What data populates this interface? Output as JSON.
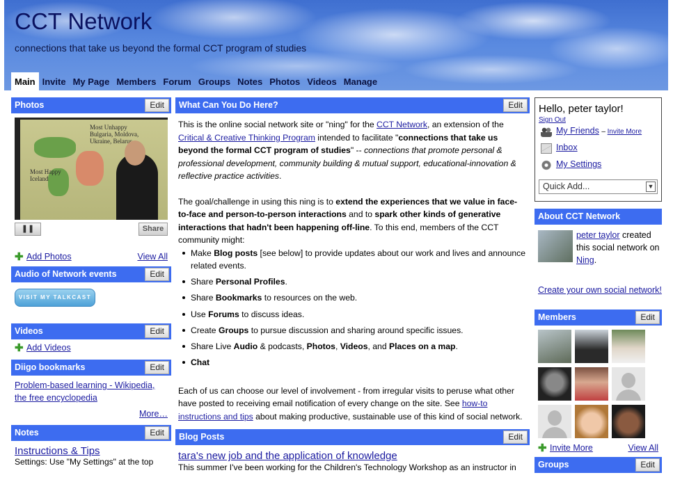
{
  "header": {
    "title": "CCT Network",
    "tagline": "connections that take us beyond the formal CCT program of studies"
  },
  "nav": {
    "tabs": [
      {
        "label": "Main"
      },
      {
        "label": "Invite"
      },
      {
        "label": "My Page"
      },
      {
        "label": "Members"
      },
      {
        "label": "Forum"
      },
      {
        "label": "Groups"
      },
      {
        "label": "Notes"
      },
      {
        "label": "Photos"
      },
      {
        "label": "Videos"
      },
      {
        "label": "Manage"
      }
    ],
    "active": "Main"
  },
  "common": {
    "edit_label": "Edit"
  },
  "left": {
    "photos": {
      "title": "Photos",
      "slide_text_1": "Most Unhappy Bulgaria, Moldova, Ukraine, Belarus",
      "slide_text_2": "Most Happy Iceland",
      "pause_label": "❚❚",
      "share_label": "Share",
      "add_label": "Add Photos",
      "view_all_label": "View All"
    },
    "audio": {
      "title": "Audio of Network events",
      "talkcast_label": "VISIT MY TALKCAST"
    },
    "videos": {
      "title": "Videos",
      "add_label": "Add Videos"
    },
    "diigo": {
      "title": "Diigo bookmarks",
      "link": "Problem-based learning - Wikipedia, the free encyclopedia",
      "more_label": "More…"
    },
    "notes": {
      "title": "Notes",
      "note_title": "Instructions & Tips",
      "note_sub": "Settings: Use \"My Settings\" at the top"
    }
  },
  "middle": {
    "intro": {
      "title": "What Can You Do Here?",
      "p1_a": "This is the online social network site or \"ning\" for the ",
      "p1_link1": "CCT Network",
      "p1_b": ", an extension of the ",
      "p1_link2": "Critical & Creative Thinking Program",
      "p1_c": " intended to facilitate \"",
      "p1_bold": "connections that take us beyond the formal CCT program of studies",
      "p1_d": "\" -- ",
      "p1_italic": "connections that promote personal & professional development, community building & mutual support, educational-innovation & reflective practice activities",
      "p1_e": ".",
      "p2_a": "The goal/challenge in using this ning is to ",
      "p2_bold1": "extend the experiences that we value in face-to-face and person-to-person interactions",
      "p2_b": " and to ",
      "p2_bold2": "spark other kinds of generative interactions that hadn't been happening off-line",
      "p2_c": ". To this end, members of the CCT community might:",
      "list": [
        {
          "a": "Make ",
          "b": "Blog posts",
          "c": " [see below] to provide updates about our work and lives and announce related events."
        },
        {
          "a": "Share ",
          "b": "Personal Profiles",
          "c": "."
        },
        {
          "a": "Share ",
          "b": "Bookmarks",
          "c": " to resources on the web."
        },
        {
          "a": "Use ",
          "b": "Forums",
          "c": " to discuss ideas."
        },
        {
          "a": "Create ",
          "b": "Groups",
          "c": " to pursue discussion and sharing around specific issues."
        },
        {
          "a": "Share Live ",
          "b": "Audio",
          "c": " & podcasts, ",
          "d": "Photos",
          "e": ", ",
          "f": "Videos",
          "g": ", and ",
          "h": "Places on a map",
          "i": "."
        },
        {
          "a": "",
          "b": "Chat",
          "c": ""
        }
      ],
      "p3_a": "Each of us can choose our level of involvement - from irregular visits to peruse what other have posted to receiving email notification of every change on the site. See ",
      "p3_link": "how-to instructions and tips",
      "p3_b": " about making productive, sustainable use of this kind of social network."
    },
    "blog": {
      "title": "Blog Posts",
      "post_title": "tara's new job and the application of knowledge",
      "post_snippet": "This summer I've been working for the Children's Technology Workshop as an instructor in"
    }
  },
  "right": {
    "user": {
      "hello": "Hello, peter taylor!",
      "signout": "Sign Out",
      "friends": "My Friends",
      "invite_more": "Invite More",
      "inbox": "Inbox",
      "settings": "My Settings",
      "quick_add": "Quick Add..."
    },
    "about": {
      "title": "About CCT Network",
      "creator": "peter taylor",
      "text_a": " created this social network on ",
      "ning": "Ning",
      "text_b": ".",
      "create_link": "Create your own social network!"
    },
    "members": {
      "title": "Members",
      "invite_label": "Invite More",
      "view_all_label": "View All"
    },
    "groups": {
      "title": "Groups"
    }
  },
  "colors": {
    "module_header": "#3d6cf0",
    "link": "#1a1aa0",
    "plus": "#3a9a2a"
  }
}
